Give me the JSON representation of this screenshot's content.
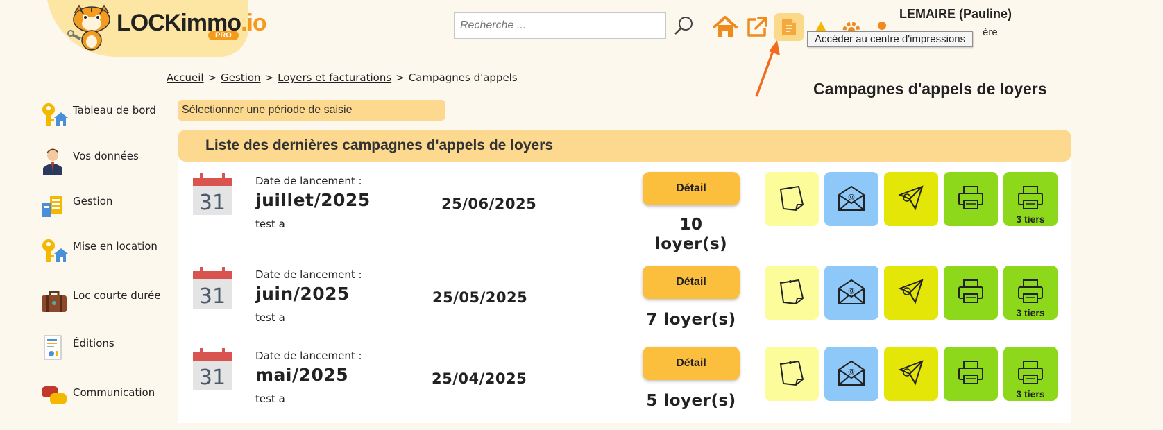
{
  "logo": {
    "text_main": "LOCKimmo",
    "text_io": ".io",
    "badge": "PRO"
  },
  "header": {
    "search_placeholder": "Recherche ...",
    "user_name": "LEMAIRE (Pauline)",
    "user_role": "ère",
    "tooltip": "Accéder au centre d'impressions",
    "icons": [
      "search-icon",
      "home-icon",
      "external-link-icon",
      "print-center-icon",
      "warning-icon",
      "settings-icon",
      "user-icon"
    ]
  },
  "breadcrumb": {
    "home": "Accueil",
    "sep": ">",
    "gestion": "Gestion",
    "loyers": "Loyers et facturations",
    "current": "Campagnes d'appels"
  },
  "page_title": "Campagnes d'appels de loyers",
  "sidebar": {
    "items": [
      {
        "label": "Tableau de bord",
        "icon": "keys-house-icon"
      },
      {
        "label": "Vos données",
        "icon": "person-icon"
      },
      {
        "label": "Gestion",
        "icon": "management-icon"
      },
      {
        "label": "Mise en location",
        "icon": "keys-house-icon"
      },
      {
        "label": "Loc courte durée",
        "icon": "suitcase-icon"
      },
      {
        "label": "Éditions",
        "icon": "report-icon"
      },
      {
        "label": "Communication",
        "icon": "chat-icon"
      }
    ]
  },
  "period_select": "Sélectionner une période de saisie",
  "list": {
    "title": "Liste des dernières campagnes d'appels de loyers",
    "calendar_day": "31",
    "launch_label": "Date de lancement :",
    "detail_label": "Détail",
    "tier_label": "3 tiers",
    "rows": [
      {
        "month": "juillet/2025",
        "note": "test a",
        "date": "25/06/2025",
        "count_line1": "10",
        "count_line2": "loyer(s)"
      },
      {
        "month": "juin/2025",
        "note": "test a",
        "date": "25/05/2025",
        "count_line1": "7 loyer(s)",
        "count_line2": ""
      },
      {
        "month": "mai/2025",
        "note": "test a",
        "date": "25/04/2025",
        "count_line1": "5 loyer(s)",
        "count_line2": ""
      }
    ],
    "actions": [
      {
        "name": "note-icon",
        "color": "#fdfc9b"
      },
      {
        "name": "email-icon",
        "color": "#8ec8f8"
      },
      {
        "name": "send-payment-icon",
        "color": "#e3e606"
      },
      {
        "name": "printer-icon",
        "color": "#8ed81c"
      },
      {
        "name": "printer-third-party-icon",
        "color": "#8ed81c"
      }
    ]
  },
  "colors": {
    "accent": "#fcd98f",
    "detail_button": "#fbbe3d",
    "arrow": "#f26b1d"
  }
}
